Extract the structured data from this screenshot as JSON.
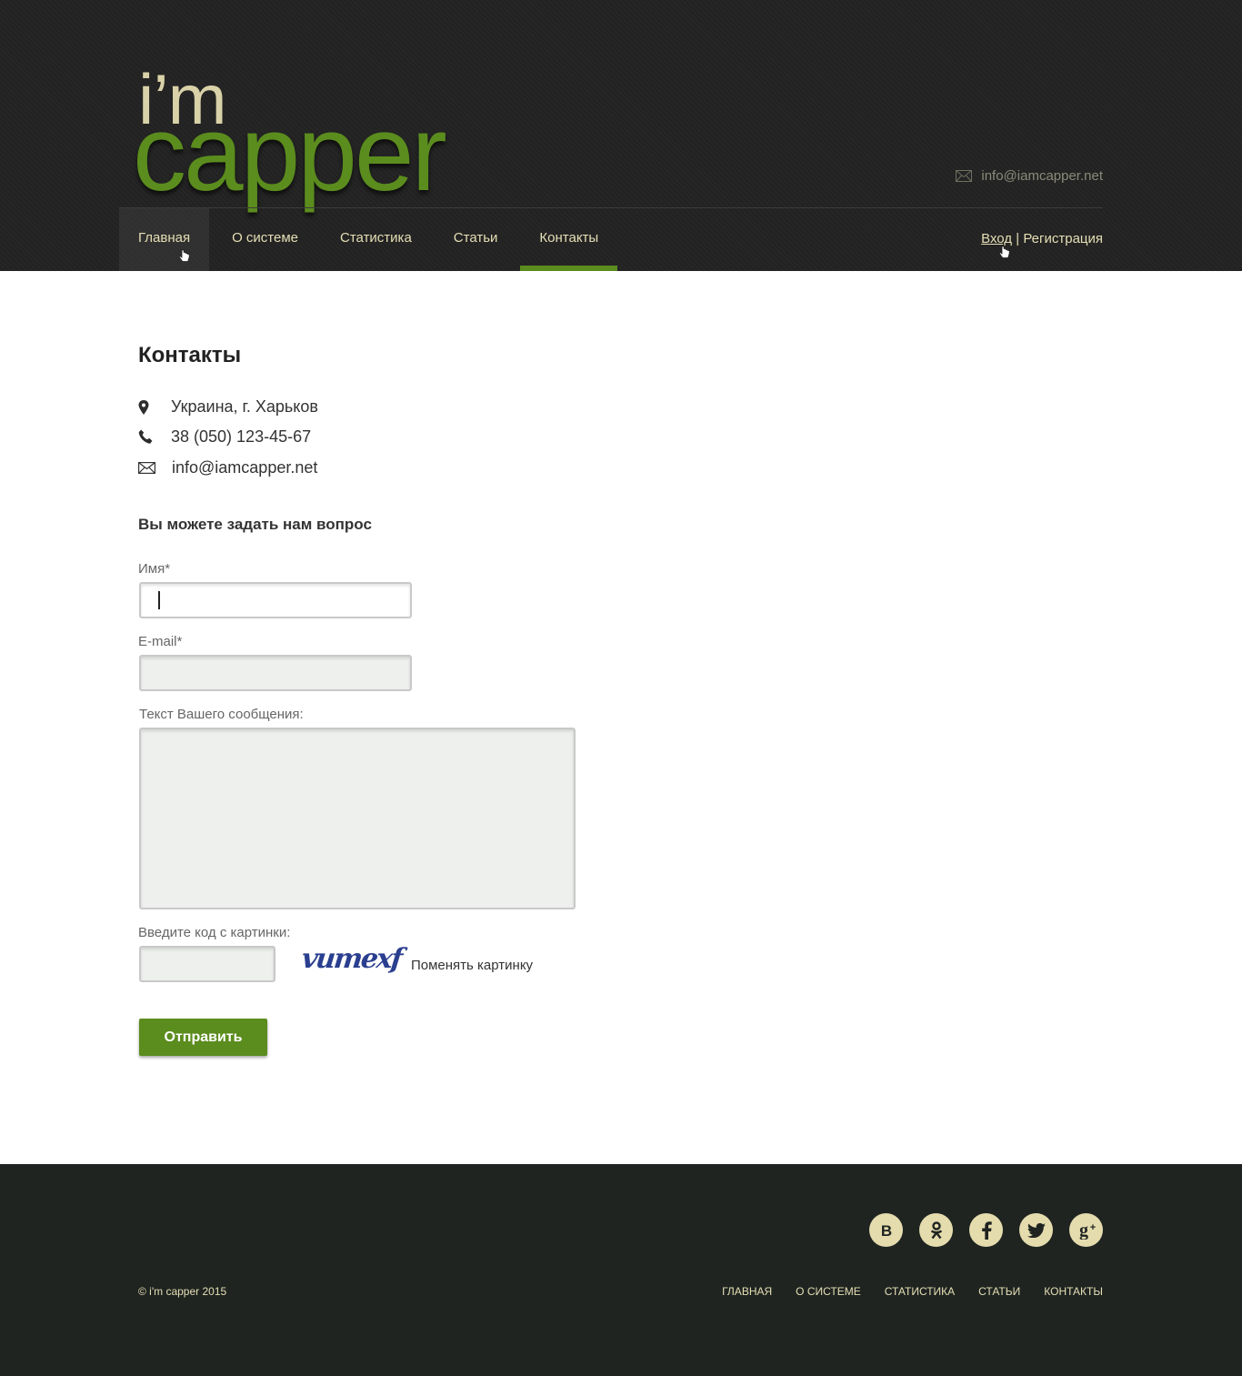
{
  "brand": {
    "logo_top": "i’m",
    "logo_bottom": "capper"
  },
  "header": {
    "email": "info@iamcapper.net"
  },
  "nav": {
    "items": [
      {
        "label": "Главная"
      },
      {
        "label": "О системе"
      },
      {
        "label": "Статистика"
      },
      {
        "label": "Статьи"
      },
      {
        "label": "Контакты"
      }
    ],
    "active": "Контакты"
  },
  "auth": {
    "login": "Вход",
    "separator": "|",
    "register": "Регистрация"
  },
  "contacts": {
    "title": "Контакты",
    "address": "Украина, г. Харьков",
    "phone": "38 (050) 123-45-67",
    "email": "info@iamcapper.net"
  },
  "form": {
    "heading": "Вы можете задать нам вопрос",
    "name_label": "Имя*",
    "name_value": "",
    "email_label": "E-mail*",
    "email_value": "",
    "message_label": "Текст Вашего сообщения:",
    "message_value": "",
    "captcha_label": "Введите код с картинки:",
    "captcha_value": "",
    "captcha_text": "vumexf",
    "change_captcha": "Поменять картинку",
    "submit": "Отправить"
  },
  "footer": {
    "socials": [
      "B",
      "ok",
      "f",
      "twitter",
      "g+"
    ],
    "copyright": "© i'm capper 2015",
    "nav": [
      "ГЛАВНАЯ",
      "О СИСТЕМЕ",
      "СТАТИСТИКА",
      "СТАТЬИ",
      "КОНТАКТЫ"
    ]
  },
  "colors": {
    "accent": "#5b8c1e",
    "header_bg": "#232323",
    "footer_bg": "#1f2421",
    "cream": "#e6dfb5"
  }
}
